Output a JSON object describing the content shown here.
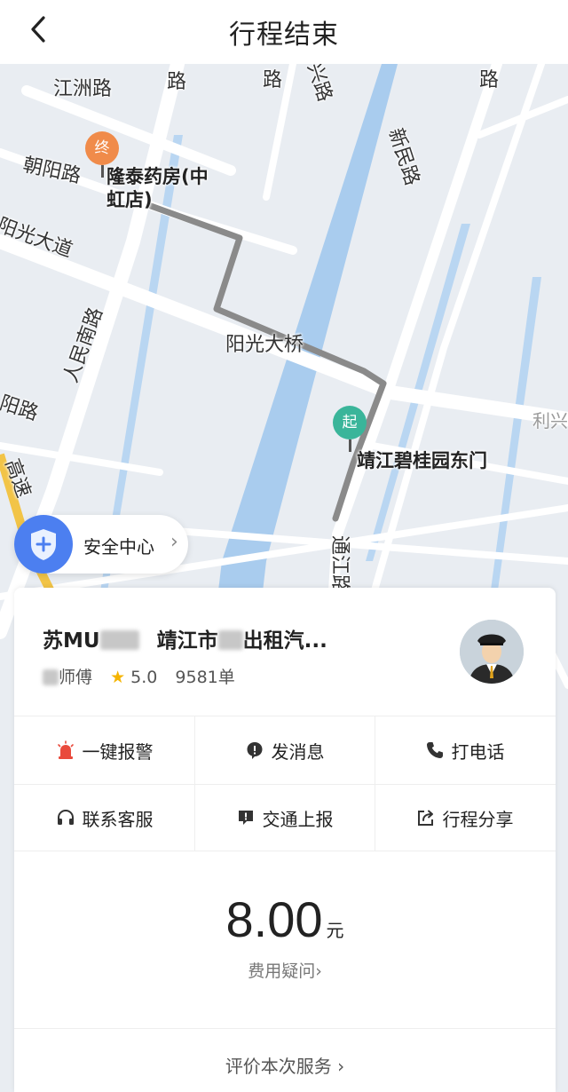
{
  "header": {
    "title": "行程结束",
    "back_icon": "chevron-left-icon"
  },
  "map": {
    "road_labels": [
      "江洲路",
      "朝阳路",
      "阳光大道",
      "人民南路",
      "阳路",
      "新民路",
      "阳光大桥",
      "通江路",
      "利兴",
      "路",
      "路",
      "兴路",
      "路",
      "高速"
    ],
    "end_marker": {
      "badge": "终",
      "name_line1": "隆泰药房(中",
      "name_line2": "虹店)"
    },
    "start_marker": {
      "badge": "起",
      "name": "靖江碧桂园东门"
    }
  },
  "safety_center": {
    "label": "安全中心",
    "chevron": "›"
  },
  "driver": {
    "plate_prefix": "苏MU",
    "company_prefix": "靖江市",
    "company_suffix": "出租汽...",
    "name_suffix": "师傅",
    "rating": "5.0",
    "orders": "9581单"
  },
  "actions": [
    {
      "label": "一键报警",
      "icon": "alarm-icon"
    },
    {
      "label": "发消息",
      "icon": "message-icon"
    },
    {
      "label": "打电话",
      "icon": "phone-icon"
    },
    {
      "label": "联系客服",
      "icon": "headset-icon"
    },
    {
      "label": "交通上报",
      "icon": "report-icon"
    },
    {
      "label": "行程分享",
      "icon": "share-icon"
    }
  ],
  "fare": {
    "amount": "8.00",
    "unit": "元",
    "question": "费用疑问",
    "question_chevron": "›"
  },
  "rate_service": {
    "label": "评价本次服务",
    "chevron": "›"
  },
  "colors": {
    "accent_blue": "#4c7ff0",
    "end_orange": "#f08b4a",
    "start_green": "#3ab59a",
    "river": "#a9ccee",
    "route": "#8a8a8a",
    "alarm_red": "#e94a3c"
  }
}
